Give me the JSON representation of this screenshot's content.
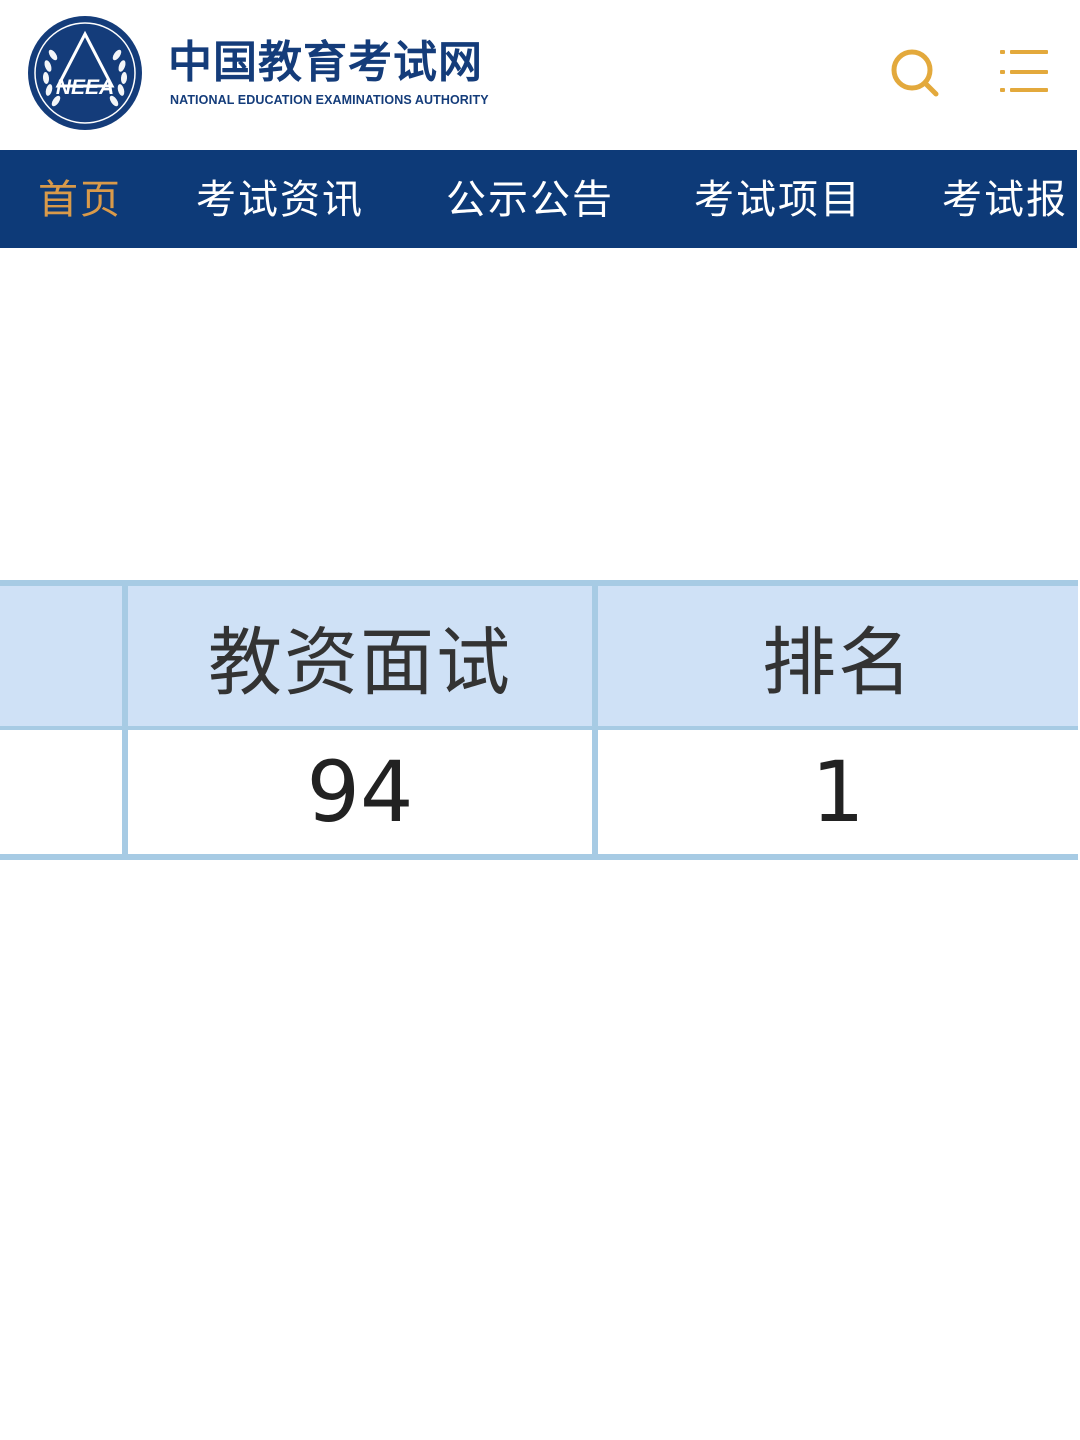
{
  "header": {
    "logo_text": "NEEA",
    "title": "中国教育考试网",
    "subtitle": "NATIONAL EDUCATION EXAMINATIONS AUTHORITY",
    "brand_color": "#143c7a",
    "search_icon": "search-icon",
    "menu_icon": "menu-icon",
    "icon_color": "#e3a93c"
  },
  "nav": {
    "background": "#0d3a78",
    "active_color": "#d99a4a",
    "items": [
      {
        "label": "首页",
        "active": true
      },
      {
        "label": "考试资讯",
        "active": false
      },
      {
        "label": "公示公告",
        "active": false
      },
      {
        "label": "考试项目",
        "active": false
      },
      {
        "label": "考试报",
        "active": false
      }
    ]
  },
  "score_table": {
    "headers": [
      "",
      "教资面试",
      "排名"
    ],
    "rows": [
      [
        "",
        "94",
        "1"
      ]
    ],
    "header_background": "#cfe1f6",
    "border_color": "#a7cbe4"
  }
}
